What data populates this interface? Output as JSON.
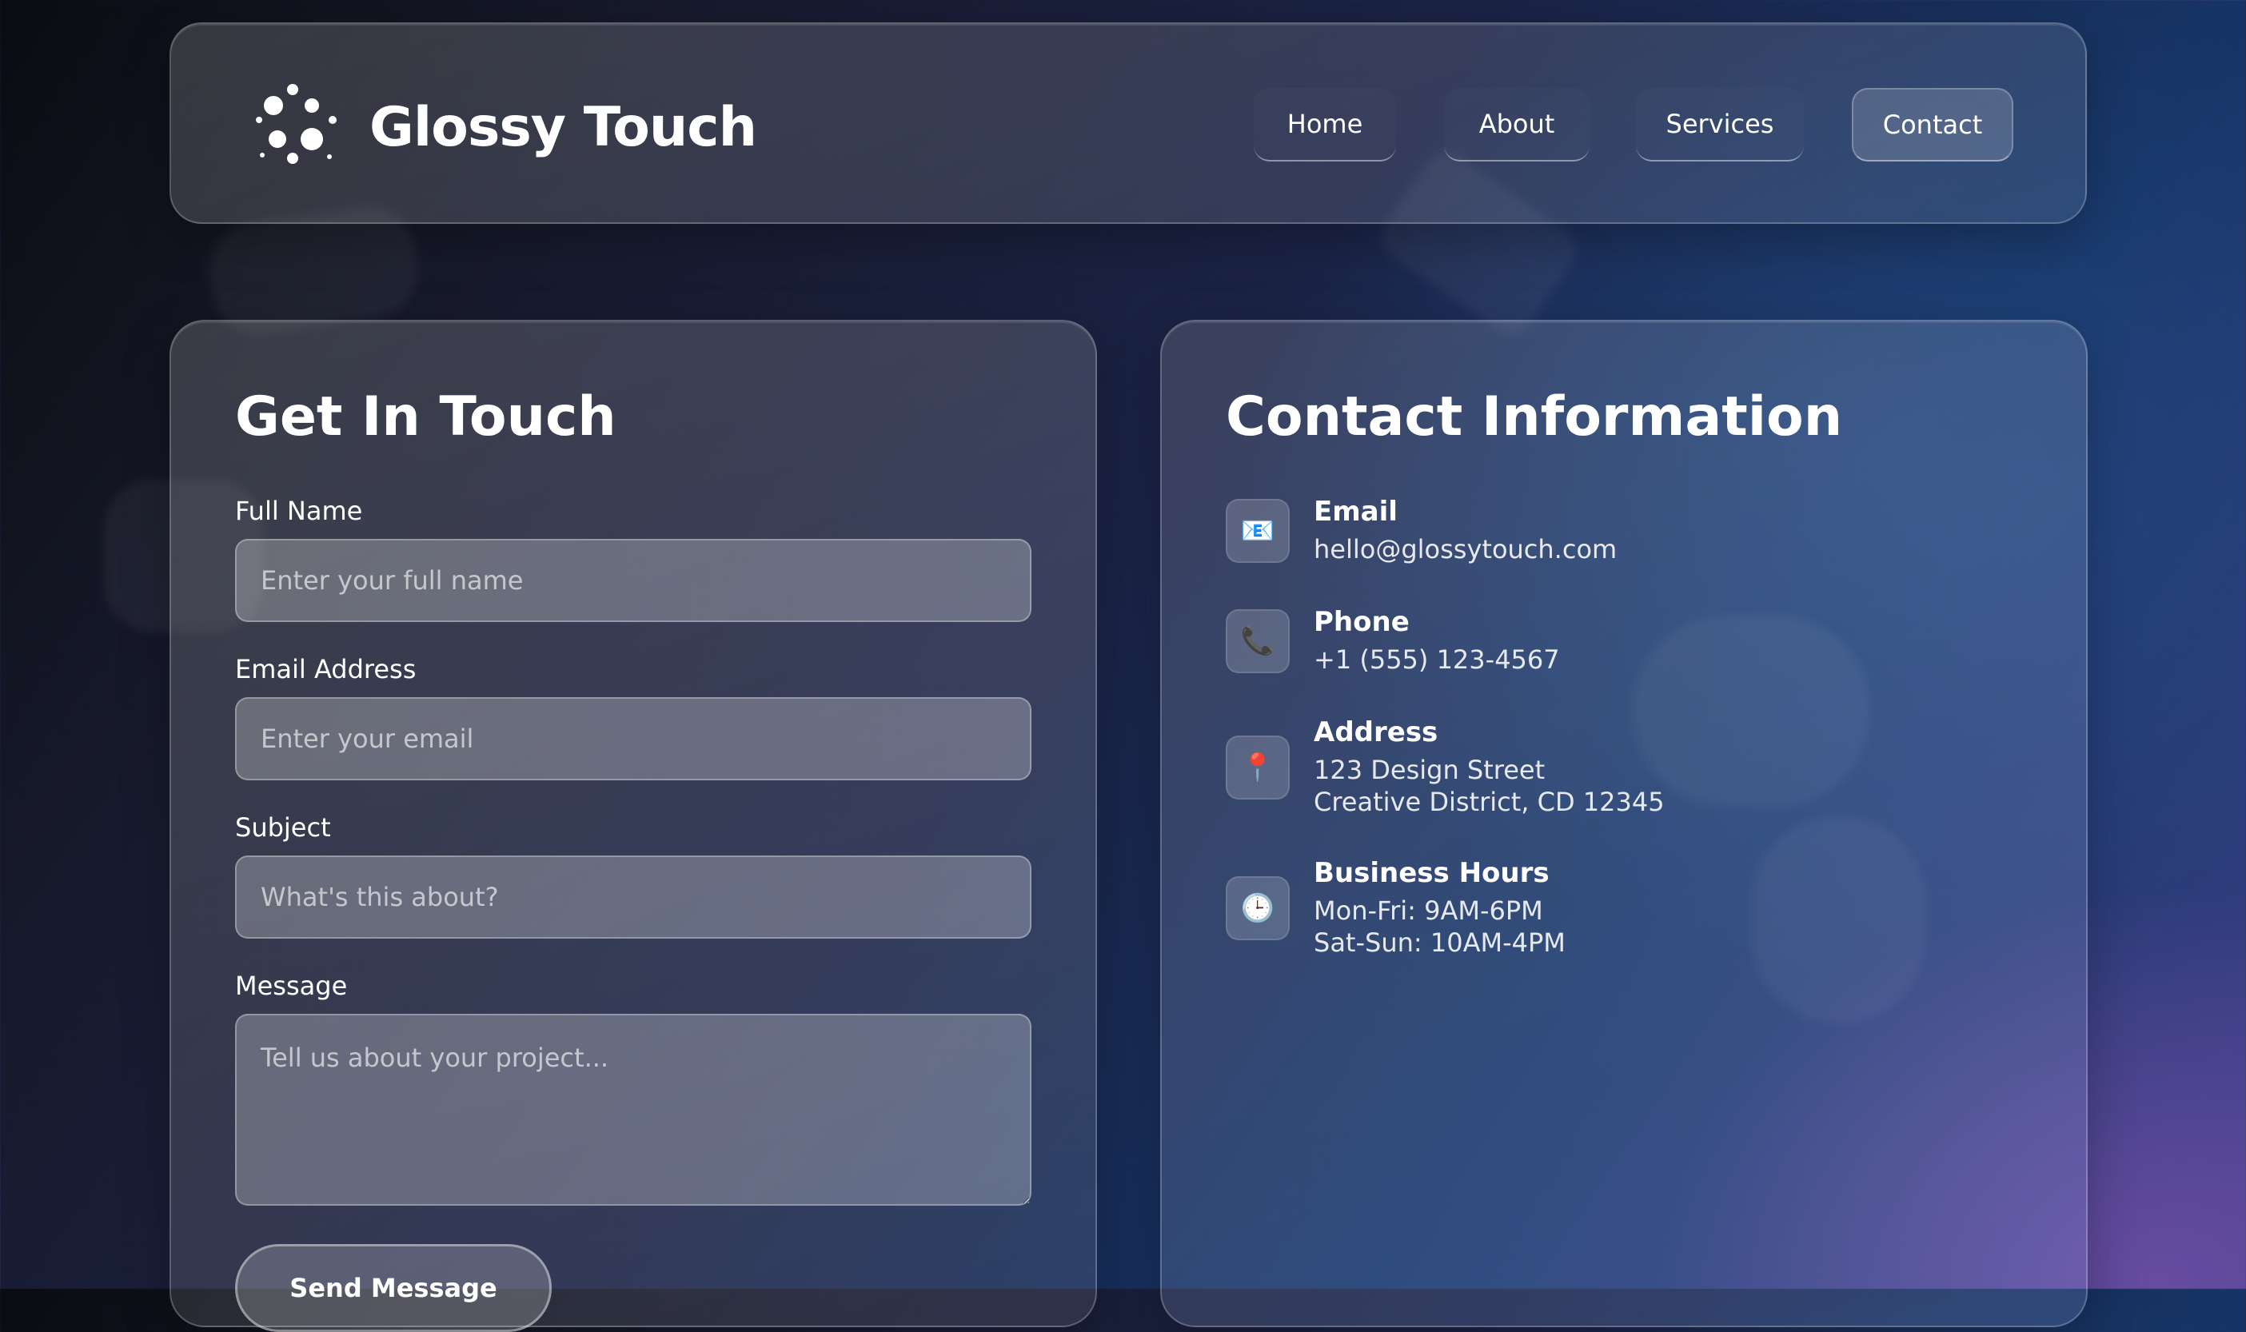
{
  "header": {
    "brand": "Glossy Touch",
    "logo_icon": "dots-sparkle-icon",
    "nav": [
      {
        "label": "Home",
        "active": false
      },
      {
        "label": "About",
        "active": false
      },
      {
        "label": "Services",
        "active": false
      },
      {
        "label": "Contact",
        "active": true
      }
    ]
  },
  "form": {
    "title": "Get In Touch",
    "fields": {
      "full_name": {
        "label": "Full Name",
        "placeholder": "Enter your full name",
        "value": ""
      },
      "email": {
        "label": "Email Address",
        "placeholder": "Enter your email",
        "value": ""
      },
      "subject": {
        "label": "Subject",
        "placeholder": "What's this about?",
        "value": ""
      },
      "message": {
        "label": "Message",
        "placeholder": "Tell us about your project...",
        "value": ""
      }
    },
    "submit_label": "Send Message"
  },
  "contact_info": {
    "title": "Contact Information",
    "items": [
      {
        "icon": "envelope-icon",
        "glyph": "📧",
        "heading": "Email",
        "lines": [
          "hello@glossytouch.com"
        ]
      },
      {
        "icon": "phone-icon",
        "glyph": "📞",
        "heading": "Phone",
        "lines": [
          "+1 (555) 123-4567"
        ]
      },
      {
        "icon": "map-pin-icon",
        "glyph": "📍",
        "heading": "Address",
        "lines": [
          "123 Design Street",
          "Creative District, CD 12345"
        ]
      },
      {
        "icon": "clock-icon",
        "glyph": "🕒",
        "heading": "Business Hours",
        "lines": [
          "Mon-Fri: 9AM-6PM",
          "Sat-Sun: 10AM-4PM"
        ]
      }
    ]
  },
  "colors": {
    "background_dark": "#0b0c12",
    "background_blue": "#163566",
    "background_purple": "#3a3f86",
    "text": "#ffffff"
  }
}
